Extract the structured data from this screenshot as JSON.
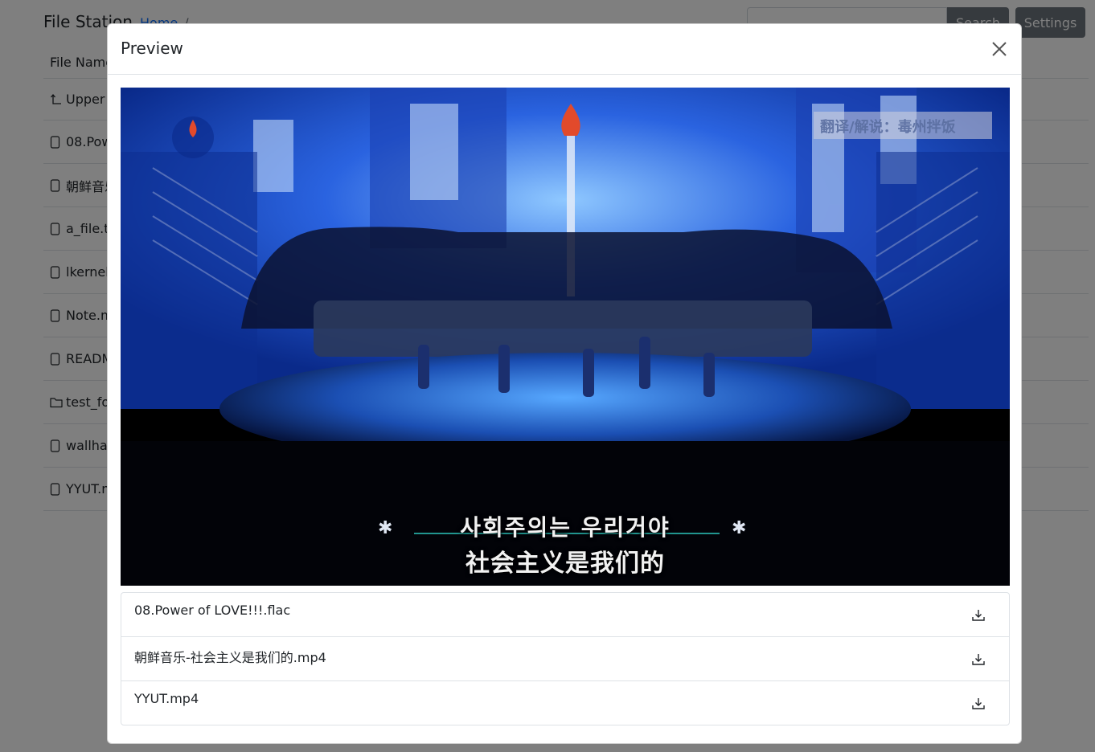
{
  "app": {
    "title": "File Station"
  },
  "breadcrumb": {
    "home": "Home",
    "separator": "/"
  },
  "header": {
    "search_placeholder": "",
    "search_label": "Search",
    "settings_label": "Settings"
  },
  "file_table": {
    "column_header": "File Name",
    "upper_label": "Upper",
    "rows": [
      {
        "name": "08.Pow",
        "kind": "file"
      },
      {
        "name": "朝鲜音乐",
        "kind": "file"
      },
      {
        "name": "a_file.tx",
        "kind": "file"
      },
      {
        "name": "lkernel",
        "kind": "file"
      },
      {
        "name": "Note.m",
        "kind": "file"
      },
      {
        "name": "READM",
        "kind": "file"
      },
      {
        "name": "test_fo",
        "kind": "folder"
      },
      {
        "name": "wallhav",
        "kind": "file"
      },
      {
        "name": "YYUT.m",
        "kind": "file"
      }
    ]
  },
  "modal": {
    "title": "Preview",
    "video": {
      "subtitle_korean": "사회주의는 우리거야",
      "subtitle_chinese": "社会主义是我们的",
      "watermark": "翻译/解说：毒州拌饭"
    },
    "files": [
      {
        "name": "08.Power of LOVE!!!.flac"
      },
      {
        "name": "朝鲜音乐-社会主义是我们的.mp4"
      },
      {
        "name": "YYUT.mp4"
      }
    ]
  },
  "colors": {
    "link": "#0d6efd",
    "secondary_button": "#6c757d",
    "stage_blue": "#1a4fd6"
  }
}
